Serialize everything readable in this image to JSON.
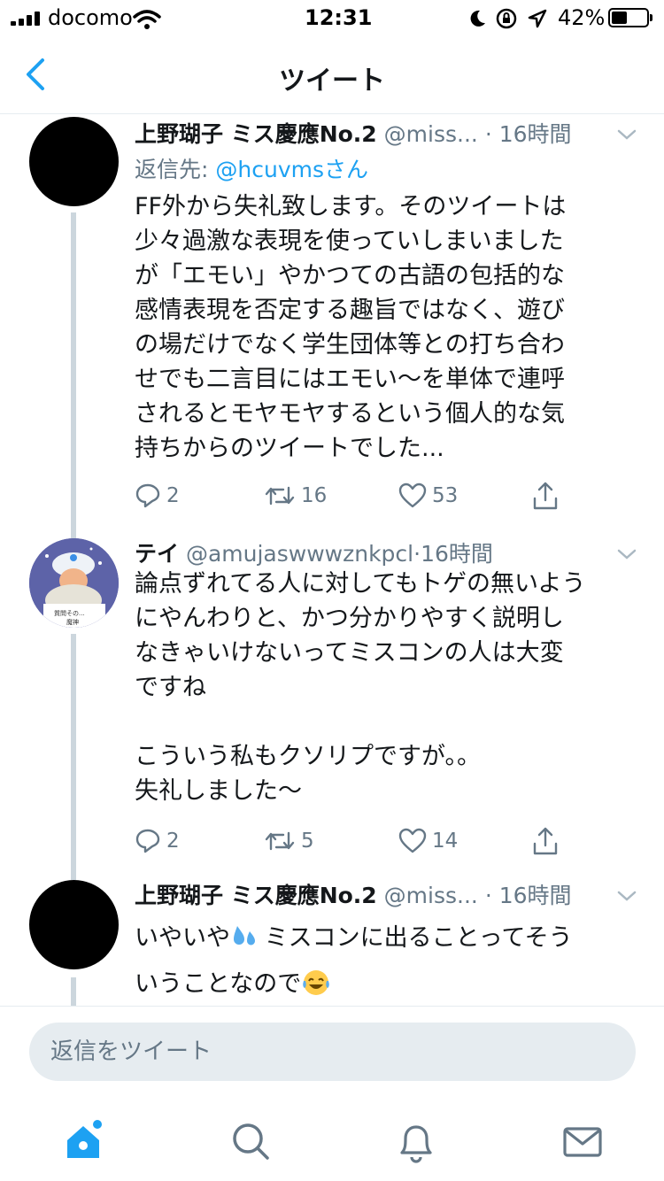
{
  "status_bar": {
    "carrier": "docomo",
    "time": "12:31",
    "battery": "42%"
  },
  "nav": {
    "title": "ツイート"
  },
  "tweets": [
    {
      "name": "上野瑚子 ミス慶應No.2",
      "handle": "@miss...",
      "time": "· 16時間",
      "reply_prefix": "返信先:",
      "reply_to": "@hcuvmsさん",
      "text": "FF外から失礼致します。そのツイートは\n少々過激な表現を使っていしまいました\nが「エモい」やかつての古語の包括的な\n感情表現を否定する趣旨ではなく、遊び\nの場だけでなく学生団体等との打ち合わ\nせでも二言目にはエモい〜を単体で連呼\nされるとモヤモヤするという個人的な気\n持ちからのツイートでした...",
      "replies": "2",
      "retweets": "16",
      "likes": "53"
    },
    {
      "name": "テイ",
      "handle": "@amujaswwwznkpcl",
      "time": "·16時間",
      "avatar_text": "質問その...",
      "avatar_subtext": "魔神",
      "text": "論点ずれてる人に対してもトゲの無いよう\nにやんわりと、かつ分かりやすく説明し\nなきゃいけないってミスコンの人は大変\nですね\n\nこういう私もクソリプですが。。\n失礼しました〜",
      "replies": "2",
      "retweets": "5",
      "likes": "14"
    },
    {
      "name": "上野瑚子 ミス慶應No.2",
      "handle": "@miss...",
      "time": "· 16時間",
      "text_a": "いやいや",
      "text_b": " ミスコンに出ることってそう",
      "text_c": "いうことなので"
    }
  ],
  "reply_bar": {
    "placeholder": "返信をツイート"
  },
  "icons": {
    "reply": "reply-icon",
    "retweet": "retweet-icon",
    "like": "heart-icon",
    "share": "share-icon",
    "home": "home-icon",
    "search": "search-icon",
    "notifications": "bell-icon",
    "messages": "mail-icon"
  },
  "colors": {
    "accent": "#1da1f2",
    "secondary_text": "#657786",
    "border": "#e6ecf0"
  }
}
